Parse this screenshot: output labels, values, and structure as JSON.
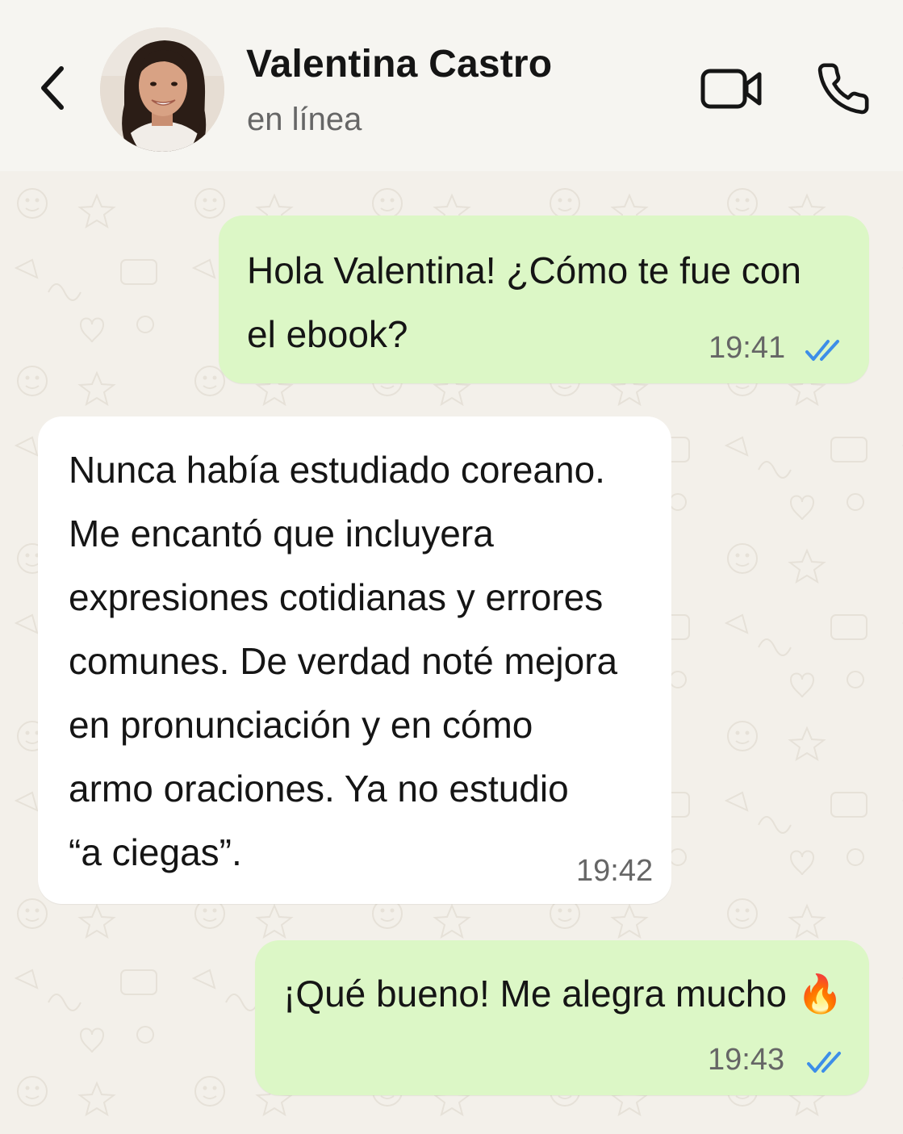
{
  "header": {
    "contact_name": "Valentina Castro",
    "status": "en línea",
    "back_icon": "chevron-left-icon",
    "video_icon": "video-camera-icon",
    "call_icon": "phone-icon"
  },
  "messages": [
    {
      "direction": "outgoing",
      "text": "Hola Valentina! ¿Cómo te fue con\nel ebook?",
      "time": "19:41",
      "status": "read"
    },
    {
      "direction": "incoming",
      "text": "Nunca había estudiado coreano.\nMe encantó que incluyera\nexpresiones cotidianas y errores\ncomunes. De verdad noté mejora\nen pronunciación y en cómo\narmo oraciones. Ya no estudio\n“a ciegas”.",
      "time": "19:42"
    },
    {
      "direction": "outgoing",
      "text": "¡Qué bueno! Me alegra mucho",
      "emoji": "🔥",
      "time": "19:43",
      "status": "read"
    }
  ],
  "colors": {
    "header_bg": "#f6f5f1",
    "chat_bg": "#f3f0ea",
    "outgoing_bubble": "#dcf7c6",
    "incoming_bubble": "#ffffff",
    "read_ticks": "#3d8ee8"
  }
}
